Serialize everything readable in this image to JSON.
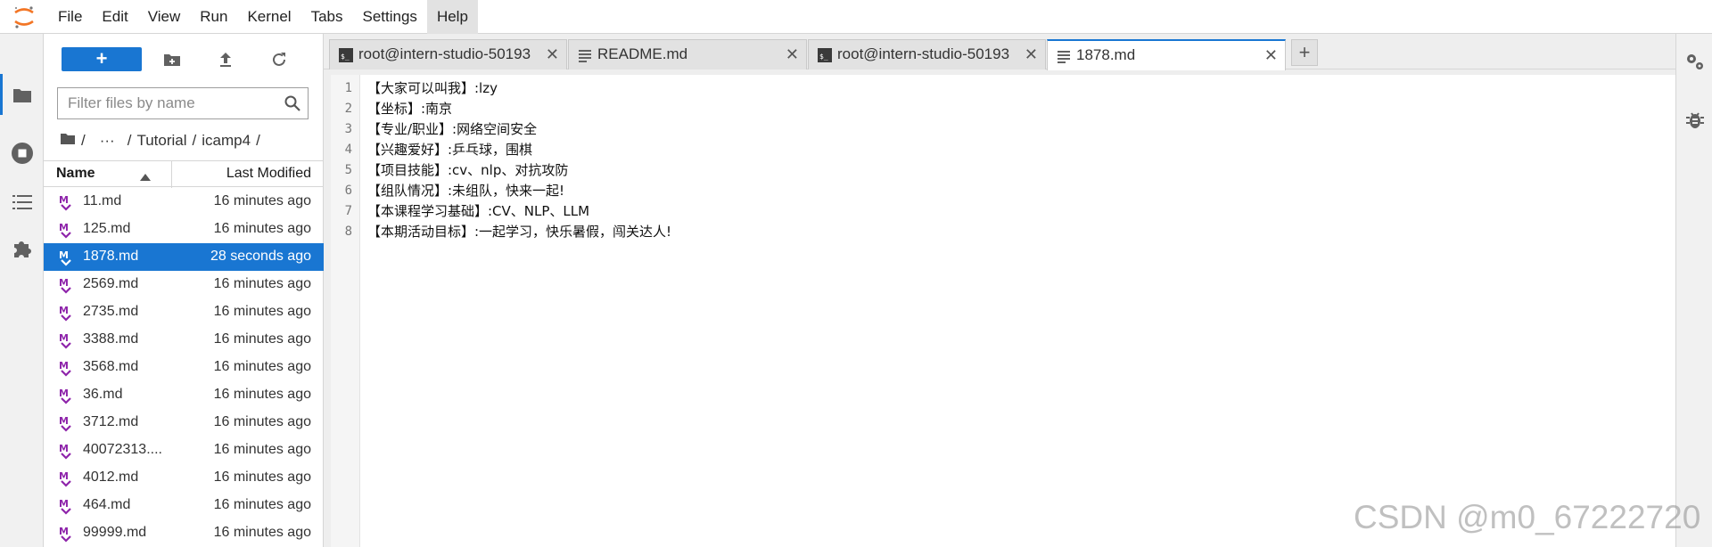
{
  "menu": [
    "File",
    "Edit",
    "View",
    "Run",
    "Kernel",
    "Tabs",
    "Settings",
    "Help"
  ],
  "menu_active": "Help",
  "filebrowser": {
    "filter_placeholder": "Filter files by name",
    "breadcrumb": [
      "/",
      "···",
      "/",
      "Tutorial",
      "/",
      "icamp4",
      "/"
    ],
    "columns": {
      "name": "Name",
      "modified": "Last Modified"
    },
    "files": [
      {
        "name": "11.md",
        "modified": "16 minutes ago",
        "selected": false
      },
      {
        "name": "125.md",
        "modified": "16 minutes ago",
        "selected": false
      },
      {
        "name": "1878.md",
        "modified": "28 seconds ago",
        "selected": true
      },
      {
        "name": "2569.md",
        "modified": "16 minutes ago",
        "selected": false
      },
      {
        "name": "2735.md",
        "modified": "16 minutes ago",
        "selected": false
      },
      {
        "name": "3388.md",
        "modified": "16 minutes ago",
        "selected": false
      },
      {
        "name": "3568.md",
        "modified": "16 minutes ago",
        "selected": false
      },
      {
        "name": "36.md",
        "modified": "16 minutes ago",
        "selected": false
      },
      {
        "name": "3712.md",
        "modified": "16 minutes ago",
        "selected": false
      },
      {
        "name": "40072313....",
        "modified": "16 minutes ago",
        "selected": false
      },
      {
        "name": "4012.md",
        "modified": "16 minutes ago",
        "selected": false
      },
      {
        "name": "464.md",
        "modified": "16 minutes ago",
        "selected": false
      },
      {
        "name": "99999.md",
        "modified": "16 minutes ago",
        "selected": false
      }
    ]
  },
  "tabs": [
    {
      "label": "root@intern-studio-50193",
      "icon": "terminal-icon",
      "active": false
    },
    {
      "label": "README.md",
      "icon": "text-file-icon",
      "active": false
    },
    {
      "label": "root@intern-studio-50193",
      "icon": "terminal-icon",
      "active": false
    },
    {
      "label": "1878.md",
      "icon": "text-file-icon",
      "active": true
    }
  ],
  "editor": {
    "lines": [
      {
        "n": "1",
        "text": "【大家可以叫我】:lzy"
      },
      {
        "n": "2",
        "text": "【坐标】:南京"
      },
      {
        "n": "3",
        "text": "【专业/职业】:网络空间安全"
      },
      {
        "n": "4",
        "text": "【兴趣爱好】:乒乓球，围棋"
      },
      {
        "n": "5",
        "text": "【项目技能】:cv、nlp、对抗攻防"
      },
      {
        "n": "6",
        "text": "【组队情况】:未组队，快来一起!"
      },
      {
        "n": "7",
        "text": "【本课程学习基础】:CV、NLP、LLM"
      },
      {
        "n": "8",
        "text": "【本期活动目标】:一起学习，快乐暑假，闯关达人!"
      }
    ]
  },
  "watermark": "CSDN @m0_67222720",
  "colors": {
    "accent": "#1976d2",
    "markdown_icon": "#8e24aa",
    "logo": "#f37626"
  }
}
